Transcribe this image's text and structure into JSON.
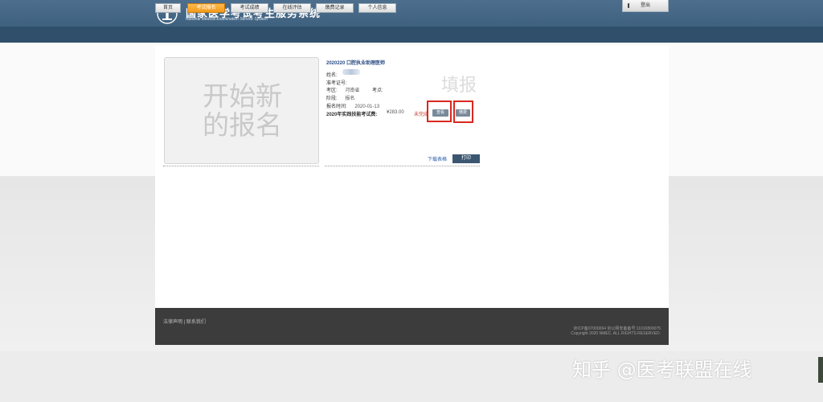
{
  "header": {
    "title": "国家医学考试考生服务系统",
    "subtitle": "National Medical Examination Service System",
    "logout_label": "登出"
  },
  "nav": {
    "items": [
      {
        "label": "首页",
        "active": false
      },
      {
        "label": "考试报名",
        "active": true
      },
      {
        "label": "考试成绩",
        "active": false
      },
      {
        "label": "在线评估",
        "active": false
      },
      {
        "label": "缴费记录",
        "active": false
      },
      {
        "label": "个人信息",
        "active": false
      }
    ]
  },
  "new_registration": {
    "line1": "开始新",
    "line2": "的报名"
  },
  "registration": {
    "exam_title": "2020220 口腔执业助理医师",
    "name_label": "姓名:",
    "admission_label": "准考证号:",
    "exam_area_label": "考区:",
    "exam_area_value": "河南省",
    "exam_site_label": "考点:",
    "stage_label": "阶段:",
    "stage_value": "报名",
    "reg_time_label": "报名时间:",
    "reg_time_value": "2020-01-13",
    "fee_label": "2020年实践技能考试费:",
    "fee_amount": "¥283.00",
    "fee_status": "未完成",
    "view_button": "查看",
    "pay_button": "缴费",
    "watermark": "填报",
    "download_label": "下载表格",
    "print_label": "打印"
  },
  "footer": {
    "links": "法律声明 | 联系我们",
    "icp": "京ICP备07000064 京公网安备备号:11010800075",
    "copyright": "Copyright 2020 NMEC. ALL RIGHTS RESERVED."
  },
  "watermark_bottom": "知乎 @医考联盟在线",
  "colors": {
    "header": "#4d6f8d",
    "navbar": "#2f4f6a",
    "active_tab": "#f29a1c",
    "highlight_box": "#d9281f",
    "print_button": "#3b5671"
  }
}
